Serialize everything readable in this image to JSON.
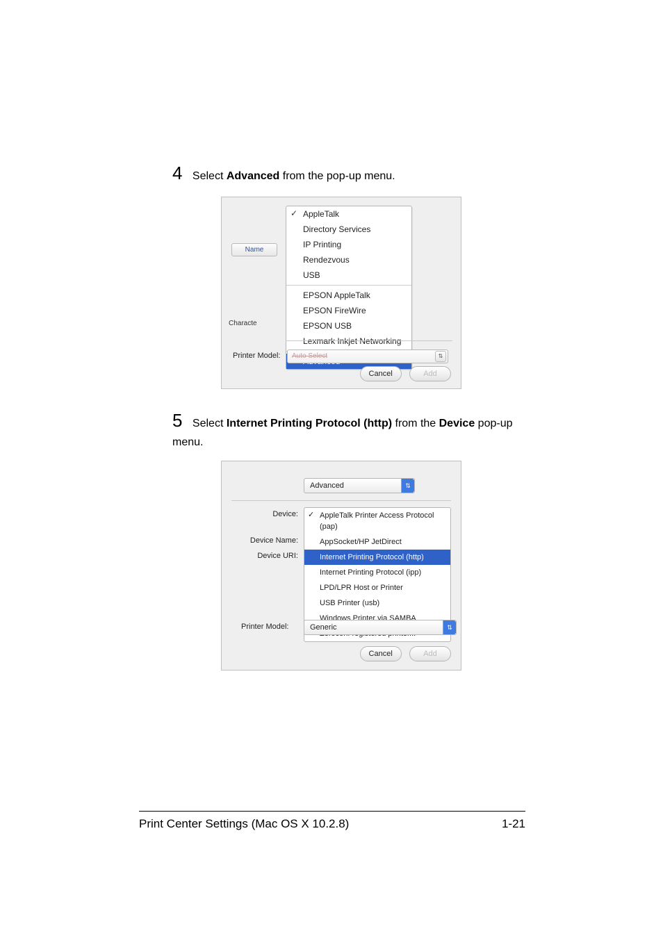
{
  "step4": {
    "num": "4",
    "pre": "Select ",
    "bold": "Advanced",
    "post": " from the pop-up menu."
  },
  "step5": {
    "num": "5",
    "pre": "Select ",
    "bold": "Internet Printing Protocol (http)",
    "mid": " from the ",
    "bold2": "Device",
    "post": " pop-up menu."
  },
  "shot1": {
    "name_tab": "Name",
    "charset_label": "Characte",
    "menu": {
      "g1": [
        "AppleTalk",
        "Directory Services",
        "IP Printing",
        "Rendezvous",
        "USB"
      ],
      "g2": [
        "EPSON AppleTalk",
        "EPSON FireWire",
        "EPSON USB",
        "Lexmark Inkjet Networking"
      ],
      "g3": [
        "Advanced"
      ],
      "checked": "AppleTalk",
      "highlighted": "Advanced"
    },
    "printer_model_label": "Printer Model:",
    "printer_model_value": "Auto Select",
    "cancel": "Cancel",
    "add": "Add"
  },
  "shot2": {
    "top_button": "Advanced",
    "labels": {
      "device": "Device:",
      "device_name": "Device Name:",
      "device_uri": "Device URI:"
    },
    "menu": {
      "items": [
        "AppleTalk Printer Access Protocol (pap)",
        "AppSocket/HP JetDirect",
        "Internet Printing Protocol (http)",
        "Internet Printing Protocol (ipp)",
        "LPD/LPR Host or Printer",
        "USB Printer (usb)",
        "Windows Printer via SAMBA",
        "Zeroconf registered printer..."
      ],
      "checked": "AppleTalk Printer Access Protocol (pap)",
      "highlighted": "Internet Printing Protocol (http)"
    },
    "printer_model_label": "Printer Model:",
    "printer_model_value": "Generic",
    "cancel": "Cancel",
    "add": "Add"
  },
  "footer": {
    "title": "Print Center Settings (Mac OS X 10.2.8)",
    "page": "1-21"
  }
}
